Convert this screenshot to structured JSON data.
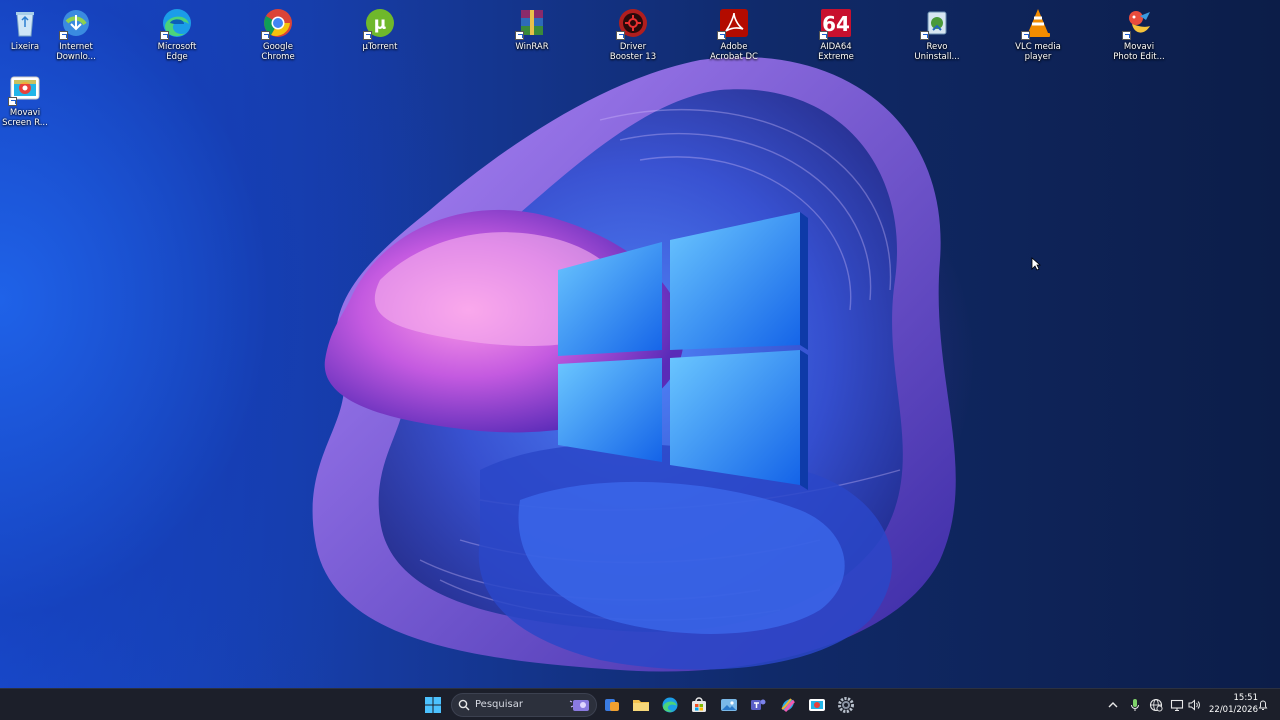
{
  "desktop": {
    "icons": [
      {
        "id": "lixeira",
        "label": "Lixeira",
        "icon": "recycle-bin-icon"
      },
      {
        "id": "internet-download",
        "label": "Internet\nDownlo...",
        "icon": "idm-icon"
      },
      {
        "id": "edge",
        "label": "Microsoft\nEdge",
        "icon": "edge-icon"
      },
      {
        "id": "chrome",
        "label": "Google\nChrome",
        "icon": "chrome-icon"
      },
      {
        "id": "utorrent",
        "label": "µTorrent",
        "icon": "utorrent-icon"
      },
      {
        "id": "winrar",
        "label": "WinRAR",
        "icon": "winrar-icon"
      },
      {
        "id": "driver-booster",
        "label": "Driver\nBooster 13",
        "icon": "driver-booster-icon"
      },
      {
        "id": "acrobat",
        "label": "Adobe\nAcrobat DC",
        "icon": "acrobat-icon"
      },
      {
        "id": "aida64",
        "label": "AIDA64\nExtreme",
        "icon": "aida64-icon"
      },
      {
        "id": "revo",
        "label": "Revo\nUninstall...",
        "icon": "revo-icon"
      },
      {
        "id": "vlc",
        "label": "VLC media\nplayer",
        "icon": "vlc-icon"
      },
      {
        "id": "movavi-photo",
        "label": "Movavi\nPhoto Edit...",
        "icon": "movavi-photo-icon"
      },
      {
        "id": "movavi-screen",
        "label": "Movavi\nScreen R...",
        "icon": "movavi-screen-icon"
      }
    ],
    "aida_glyph": "64",
    "utorrent_glyph": "µ"
  },
  "taskbar": {
    "search_placeholder": "Pesquisar",
    "pinned": [
      "start-icon",
      "widgets-icon",
      "file-explorer-icon",
      "edge-icon",
      "store-icon",
      "photos-icon",
      "teams-icon",
      "copilot-icon",
      "movavi-icon",
      "settings-icon"
    ],
    "tray": {
      "chevron": "^",
      "clock_time": "15:51",
      "clock_date": "22/01/2026"
    }
  },
  "colors": {
    "accent": "#0a78d7",
    "taskbar": "#1c1f2a",
    "windows_logo": "#2d8ff0"
  }
}
